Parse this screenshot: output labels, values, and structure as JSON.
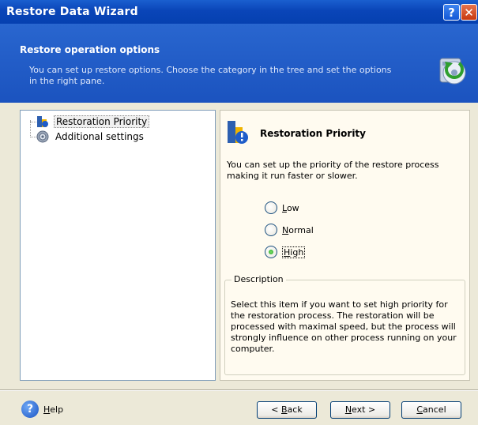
{
  "window": {
    "title": "Restore Data Wizard"
  },
  "titlebar_buttons": {
    "help": "?",
    "close": "✕"
  },
  "header": {
    "title": "Restore operation options",
    "description": "You can set up restore options. Choose the category in the tree and set the options in the right pane."
  },
  "tree": {
    "items": [
      {
        "label": "Restoration Priority",
        "icon": "priority-icon",
        "selected": true
      },
      {
        "label": "Additional settings",
        "icon": "settings-gear-icon",
        "selected": false
      }
    ]
  },
  "panel": {
    "title": "Restoration Priority",
    "description": "You can set up the priority of the restore process making it run faster or slower.",
    "options": [
      {
        "first": "L",
        "rest": "ow",
        "checked": false
      },
      {
        "first": "N",
        "rest": "ormal",
        "checked": false
      },
      {
        "first": "H",
        "rest": "igh",
        "checked": true
      }
    ],
    "group_label": "Description",
    "group_text": "Select this item if you want to set high priority for the restoration process. The restoration will be processed with maximal speed, but the process will strongly influence on other process running on your computer."
  },
  "footer": {
    "help": {
      "first": "H",
      "rest": "elp"
    },
    "back": {
      "prefix": "< ",
      "first": "B",
      "rest": "ack"
    },
    "next": {
      "first": "N",
      "rest": "ext >"
    },
    "cancel": {
      "first": "C",
      "rest": "ancel"
    }
  },
  "colors": {
    "title_bar": "#0a45b8",
    "header": "#2966cf",
    "dialog_bg": "#ece9d8",
    "pane_bg": "#fffbf0",
    "radio_check": "#21a121"
  }
}
